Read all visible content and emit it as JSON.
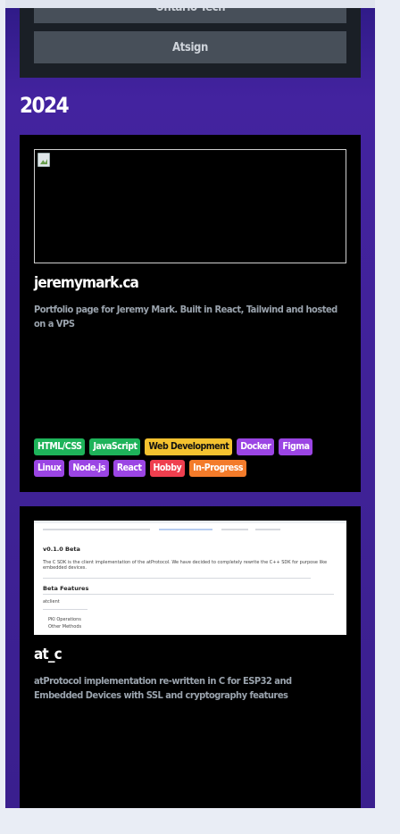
{
  "companies": [
    "Ontario Tech",
    "Atsign"
  ],
  "year": "2024",
  "projects": [
    {
      "title": "jeremymark.ca",
      "description": "Portfolio page for Jeremy Mark. Built in React, Tailwind and hosted on a VPS",
      "tags": [
        {
          "label": "HTML/CSS",
          "color": "#1eb35a"
        },
        {
          "label": "JavaScript",
          "color": "#1eb35a"
        },
        {
          "label": "Web Development",
          "color": "#f4c22f"
        },
        {
          "label": "Docker",
          "color": "#9b45e4"
        },
        {
          "label": "Figma",
          "color": "#9b45e4"
        },
        {
          "label": "Linux",
          "color": "#9b45e4"
        },
        {
          "label": "Node.js",
          "color": "#9b45e4"
        },
        {
          "label": "React",
          "color": "#9b45e4"
        },
        {
          "label": "Hobby",
          "color": "#ef3f4f"
        },
        {
          "label": "In-Progress",
          "color": "#f37b2a"
        }
      ]
    },
    {
      "title": "at_c",
      "description": "atProtocol implementation re-written in C for ESP32 and Embedded Devices with SSL and cryptography features",
      "screenshot": {
        "heading": "v0.1.0 Beta",
        "paragraph": "The C SDK is the client implementation of the atProtocol. We have decided to completely rewrite the C++ SDK for purpose like embedded devices.",
        "section": "Beta Features",
        "sub": "atclient",
        "items": [
          "PKI Operations",
          "Other Methods"
        ]
      }
    }
  ]
}
